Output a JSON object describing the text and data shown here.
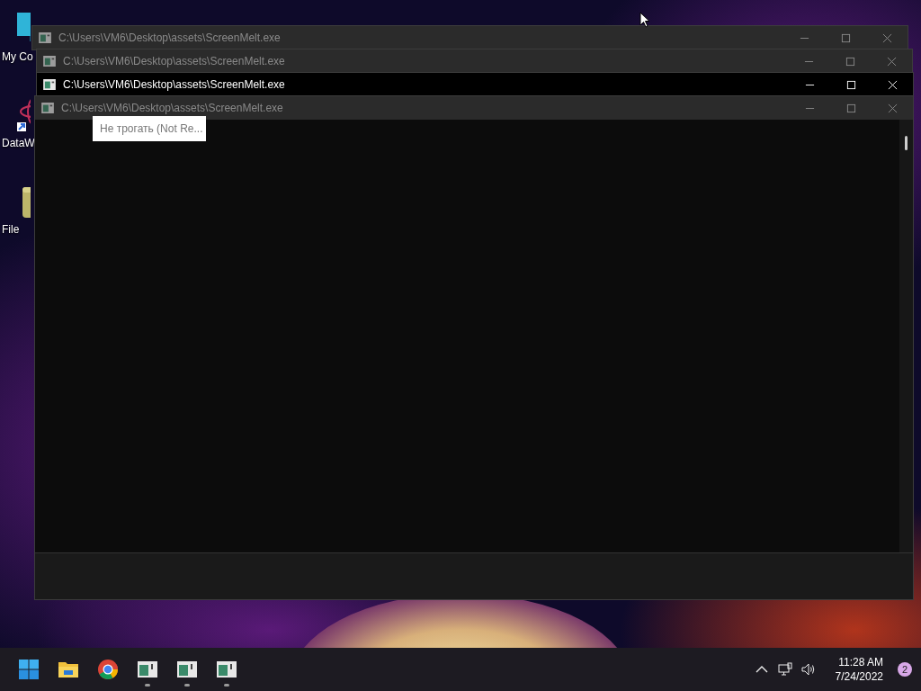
{
  "desktop": {
    "icons": [
      {
        "kind": "computer",
        "label": "My Co"
      },
      {
        "kind": "shortcut",
        "label": "DataW"
      },
      {
        "kind": "file",
        "label": "File"
      }
    ]
  },
  "windows": [
    {
      "title": "C:\\Users\\VM6\\Desktop\\assets\\ScreenMelt.exe",
      "active": false
    },
    {
      "title": "C:\\Users\\VM6\\Desktop\\assets\\ScreenMelt.exe",
      "active": false
    },
    {
      "title": "C:\\Users\\VM6\\Desktop\\assets\\ScreenMelt.exe",
      "active": true
    },
    {
      "title": "C:\\Users\\VM6\\Desktop\\assets\\ScreenMelt.exe",
      "active": false
    }
  ],
  "tooltip": {
    "text": "Не трогать (Not Re..."
  },
  "taskbar": {
    "apps": [
      {
        "kind": "start"
      },
      {
        "kind": "explorer"
      },
      {
        "kind": "chrome"
      },
      {
        "kind": "console",
        "running": true
      },
      {
        "kind": "console",
        "running": true
      },
      {
        "kind": "console",
        "running": true
      }
    ],
    "tray": {
      "time": "11:28 AM",
      "date": "7/24/2022",
      "notifications": "2"
    }
  }
}
